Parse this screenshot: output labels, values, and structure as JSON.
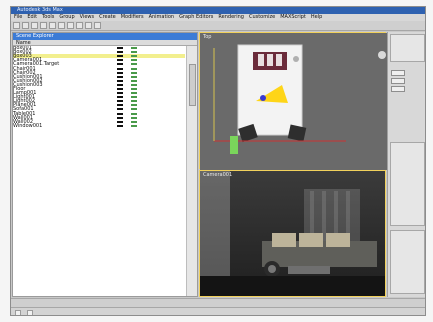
{
  "app": {
    "title": "Autodesk 3ds Max",
    "menu": [
      "File",
      "Edit",
      "Tools",
      "Group",
      "Views",
      "Create",
      "Modifiers",
      "Animation",
      "Graph Editors",
      "Rendering",
      "Customize",
      "MAXScript",
      "Help"
    ]
  },
  "scene_explorer": {
    "title": "Scene Explorer",
    "columns": [
      "Name",
      "",
      "",
      "",
      ""
    ],
    "rows": [
      {
        "name": "Box001",
        "highlight": false
      },
      {
        "name": "Box002",
        "highlight": false
      },
      {
        "name": "Box003",
        "highlight": true
      },
      {
        "name": "Camera001",
        "highlight": false
      },
      {
        "name": "Camera001.Target",
        "highlight": false
      },
      {
        "name": "Chair001",
        "highlight": false
      },
      {
        "name": "Chair002",
        "highlight": false
      },
      {
        "name": "Cushion001",
        "highlight": false
      },
      {
        "name": "Cushion002",
        "highlight": false
      },
      {
        "name": "Cushion003",
        "highlight": false
      },
      {
        "name": "Floor",
        "highlight": false
      },
      {
        "name": "Lamp001",
        "highlight": false
      },
      {
        "name": "Light001",
        "highlight": false
      },
      {
        "name": "Light002",
        "highlight": false
      },
      {
        "name": "Plane001",
        "highlight": false
      },
      {
        "name": "Sofa001",
        "highlight": false
      },
      {
        "name": "Table001",
        "highlight": false
      },
      {
        "name": "Wall001",
        "highlight": false
      },
      {
        "name": "Wall002",
        "highlight": false
      },
      {
        "name": "Window001",
        "highlight": false
      }
    ]
  },
  "viewports": {
    "top_label": "Top",
    "camera_label": "Camera001"
  },
  "status": {
    "left": "",
    "right": ""
  }
}
